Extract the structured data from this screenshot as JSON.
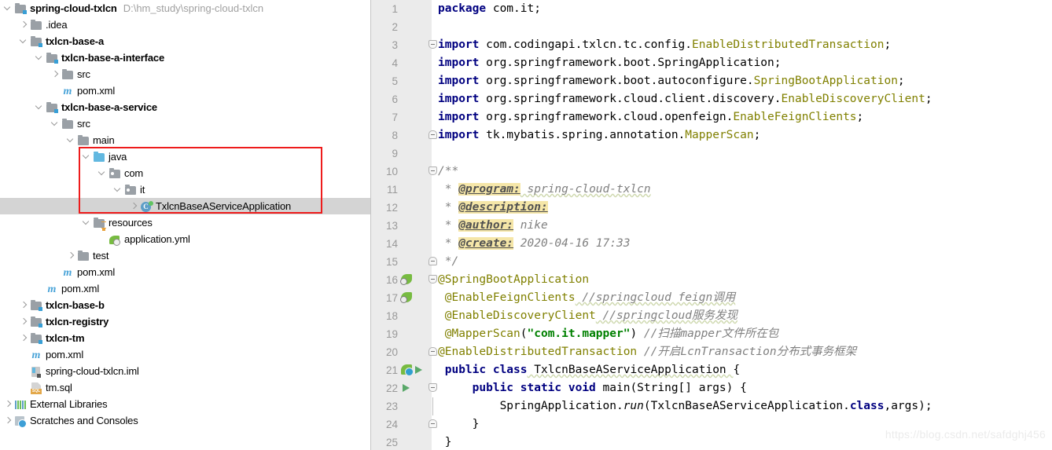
{
  "project_tree": {
    "rows": [
      {
        "indent": 0,
        "arrow": "down",
        "icon": "module-folder-icon",
        "label": "spring-cloud-txlcn",
        "bold": true,
        "path_hint": "D:\\hm_study\\spring-cloud-txlcn",
        "name": "tree-item-spring-cloud-txlcn"
      },
      {
        "indent": 1,
        "arrow": "right",
        "icon": "folder-icon",
        "label": ".idea",
        "bold": false,
        "path_hint": "",
        "name": "tree-item-idea"
      },
      {
        "indent": 1,
        "arrow": "down",
        "icon": "module-folder-icon",
        "label": "txlcn-base-a",
        "bold": true,
        "path_hint": "",
        "name": "tree-item-txlcn-base-a"
      },
      {
        "indent": 2,
        "arrow": "down",
        "icon": "module-folder-icon",
        "label": "txlcn-base-a-interface",
        "bold": true,
        "path_hint": "",
        "name": "tree-item-txlcn-base-a-interface"
      },
      {
        "indent": 3,
        "arrow": "right",
        "icon": "folder-icon",
        "label": "src",
        "bold": false,
        "path_hint": "",
        "name": "tree-item-src-interface"
      },
      {
        "indent": 3,
        "arrow": "none",
        "icon": "maven-icon",
        "label": "pom.xml",
        "bold": false,
        "path_hint": "",
        "name": "tree-item-pom-interface"
      },
      {
        "indent": 2,
        "arrow": "down",
        "icon": "module-folder-icon",
        "label": "txlcn-base-a-service",
        "bold": true,
        "path_hint": "",
        "name": "tree-item-txlcn-base-a-service"
      },
      {
        "indent": 3,
        "arrow": "down",
        "icon": "folder-icon",
        "label": "src",
        "bold": false,
        "path_hint": "",
        "name": "tree-item-src-service"
      },
      {
        "indent": 4,
        "arrow": "down",
        "icon": "folder-icon",
        "label": "main",
        "bold": false,
        "path_hint": "",
        "name": "tree-item-main"
      },
      {
        "indent": 5,
        "arrow": "down",
        "icon": "source-folder-icon",
        "label": "java",
        "bold": false,
        "path_hint": "",
        "name": "tree-item-java"
      },
      {
        "indent": 6,
        "arrow": "down",
        "icon": "package-icon",
        "label": "com",
        "bold": false,
        "path_hint": "",
        "name": "tree-item-com"
      },
      {
        "indent": 7,
        "arrow": "down",
        "icon": "package-icon",
        "label": "it",
        "bold": false,
        "path_hint": "",
        "name": "tree-item-it"
      },
      {
        "indent": 8,
        "arrow": "right",
        "icon": "java-class-icon",
        "label": "TxlcnBaseAServiceApplication",
        "bold": false,
        "path_hint": "",
        "selected": true,
        "name": "tree-item-txlcn-base-a-service-application"
      },
      {
        "indent": 5,
        "arrow": "down",
        "icon": "resources-folder-icon",
        "label": "resources",
        "bold": false,
        "path_hint": "",
        "name": "tree-item-resources"
      },
      {
        "indent": 6,
        "arrow": "none",
        "icon": "yml-icon",
        "label": "application.yml",
        "bold": false,
        "path_hint": "",
        "name": "tree-item-application-yml"
      },
      {
        "indent": 4,
        "arrow": "right",
        "icon": "folder-icon",
        "label": "test",
        "bold": false,
        "path_hint": "",
        "name": "tree-item-test"
      },
      {
        "indent": 3,
        "arrow": "none",
        "icon": "maven-icon",
        "label": "pom.xml",
        "bold": false,
        "path_hint": "",
        "name": "tree-item-pom-service"
      },
      {
        "indent": 2,
        "arrow": "none",
        "icon": "maven-icon",
        "label": "pom.xml",
        "bold": false,
        "path_hint": "",
        "name": "tree-item-pom-base-a"
      },
      {
        "indent": 1,
        "arrow": "right",
        "icon": "module-folder-icon",
        "label": "txlcn-base-b",
        "bold": true,
        "path_hint": "",
        "name": "tree-item-txlcn-base-b"
      },
      {
        "indent": 1,
        "arrow": "right",
        "icon": "module-folder-icon",
        "label": "txlcn-registry",
        "bold": true,
        "path_hint": "",
        "name": "tree-item-txlcn-registry"
      },
      {
        "indent": 1,
        "arrow": "right",
        "icon": "module-folder-icon",
        "label": "txlcn-tm",
        "bold": true,
        "path_hint": "",
        "name": "tree-item-txlcn-tm"
      },
      {
        "indent": 1,
        "arrow": "none",
        "icon": "maven-icon",
        "label": "pom.xml",
        "bold": false,
        "path_hint": "",
        "name": "tree-item-pom-root"
      },
      {
        "indent": 1,
        "arrow": "none",
        "icon": "iml-icon",
        "label": "spring-cloud-txlcn.iml",
        "bold": false,
        "path_hint": "",
        "name": "tree-item-iml"
      },
      {
        "indent": 1,
        "arrow": "none",
        "icon": "sql-icon",
        "label": "tm.sql",
        "bold": false,
        "path_hint": "",
        "name": "tree-item-tm-sql"
      },
      {
        "indent": 0,
        "arrow": "right",
        "icon": "external-libraries-icon",
        "label": "External Libraries",
        "bold": false,
        "path_hint": "",
        "name": "tree-item-external-libraries"
      },
      {
        "indent": 0,
        "arrow": "right",
        "icon": "scratches-icon",
        "label": "Scratches and Consoles",
        "bold": false,
        "path_hint": "",
        "name": "tree-item-scratches-and-consoles"
      }
    ],
    "highlight_box": {
      "color": "#ee1c1c"
    }
  },
  "editor": {
    "file": "TxlcnBaseAServiceApplication.java",
    "lines": [
      {
        "n": "1",
        "gutter": "",
        "fold": "",
        "name": "code-line-1"
      },
      {
        "n": "2",
        "gutter": "",
        "fold": "",
        "name": "code-line-2"
      },
      {
        "n": "3",
        "gutter": "",
        "fold": "top",
        "name": "code-line-3"
      },
      {
        "n": "4",
        "gutter": "",
        "fold": "",
        "name": "code-line-4"
      },
      {
        "n": "5",
        "gutter": "",
        "fold": "",
        "name": "code-line-5"
      },
      {
        "n": "6",
        "gutter": "",
        "fold": "",
        "name": "code-line-6"
      },
      {
        "n": "7",
        "gutter": "",
        "fold": "",
        "name": "code-line-7"
      },
      {
        "n": "8",
        "gutter": "",
        "fold": "bot",
        "name": "code-line-8"
      },
      {
        "n": "9",
        "gutter": "",
        "fold": "",
        "name": "code-line-9"
      },
      {
        "n": "10",
        "gutter": "",
        "fold": "top",
        "name": "code-line-10"
      },
      {
        "n": "11",
        "gutter": "",
        "fold": "",
        "name": "code-line-11"
      },
      {
        "n": "12",
        "gutter": "",
        "fold": "",
        "name": "code-line-12"
      },
      {
        "n": "13",
        "gutter": "",
        "fold": "",
        "name": "code-line-13"
      },
      {
        "n": "14",
        "gutter": "",
        "fold": "",
        "name": "code-line-14"
      },
      {
        "n": "15",
        "gutter": "",
        "fold": "bot",
        "name": "code-line-15"
      },
      {
        "n": "16",
        "gutter": "bean",
        "fold": "top",
        "name": "code-line-16"
      },
      {
        "n": "17",
        "gutter": "bean",
        "fold": "",
        "name": "code-line-17"
      },
      {
        "n": "18",
        "gutter": "",
        "fold": "",
        "name": "code-line-18"
      },
      {
        "n": "19",
        "gutter": "",
        "fold": "",
        "name": "code-line-19"
      },
      {
        "n": "20",
        "gutter": "",
        "fold": "bot",
        "name": "code-line-20"
      },
      {
        "n": "21",
        "gutter": "boot-run",
        "fold": "",
        "name": "code-line-21"
      },
      {
        "n": "22",
        "gutter": "run",
        "fold": "top",
        "name": "code-line-22"
      },
      {
        "n": "23",
        "gutter": "",
        "fold": "line",
        "name": "code-line-23"
      },
      {
        "n": "24",
        "gutter": "",
        "fold": "bot",
        "name": "code-line-24"
      },
      {
        "n": "25",
        "gutter": "",
        "fold": "",
        "name": "code-line-25"
      }
    ],
    "code_text": {
      "l1_package": "package",
      "l1_name": " com.it;",
      "l3_import": "import",
      "l3_pkg": " com.codingapi.txlcn.tc.config.",
      "l3_cls": "EnableDistributedTransaction",
      "l4_pkg": " org.springframework.boot.SpringApplication;",
      "l5_pkg": " org.springframework.boot.autoconfigure.",
      "l5_cls": "SpringBootApplication",
      "l6_pkg": " org.springframework.cloud.client.discovery.",
      "l6_cls": "EnableDiscoveryClient",
      "l7_pkg": " org.springframework.cloud.openfeign.",
      "l7_cls": "EnableFeignClients",
      "l8_pkg": " tk.mybatis.spring.annotation.",
      "l8_cls": "MapperScan",
      "l10": "/**",
      "l11_star": " * ",
      "l11_tag": "@program:",
      "l11_val": " spring-cloud-txlcn",
      "l12_tag": "@description:",
      "l13_tag": "@author:",
      "l13_val": " nike",
      "l14_tag": "@create:",
      "l14_val": " 2020-04-16 17:33",
      "l15": " */",
      "l16": "@SpringBootApplication",
      "l17_anno": "@EnableFeignClients",
      "l17_cmt": " //springcloud feign调用",
      "l18_anno": "@EnableDiscoveryClient",
      "l18_cmt": " //springcloud服务发现",
      "l19_anno": "@MapperScan",
      "l19_str": "\"com.it.mapper\"",
      "l19_cmt": " //扫描mapper文件所在包",
      "l20_anno": "@EnableDistributedTransaction",
      "l20_cmt": " //开启LcnTransaction分布式事务框架",
      "l21_kw1": "public class",
      "l21_cls": " TxlcnBaseAServiceApplication ",
      "l21_brace": "{",
      "l22_kw": "public static void",
      "l22_sig": " main(String[] args) {",
      "l23_call": "SpringApplication.",
      "l23_run": "run",
      "l23_arg": "(TxlcnBaseAServiceApplication.",
      "l23_class_kw": "class",
      "l23_tail": ",args);",
      "l24": "}",
      "l25": "}"
    }
  },
  "watermark": "https://blog.csdn.net/safdghj456"
}
